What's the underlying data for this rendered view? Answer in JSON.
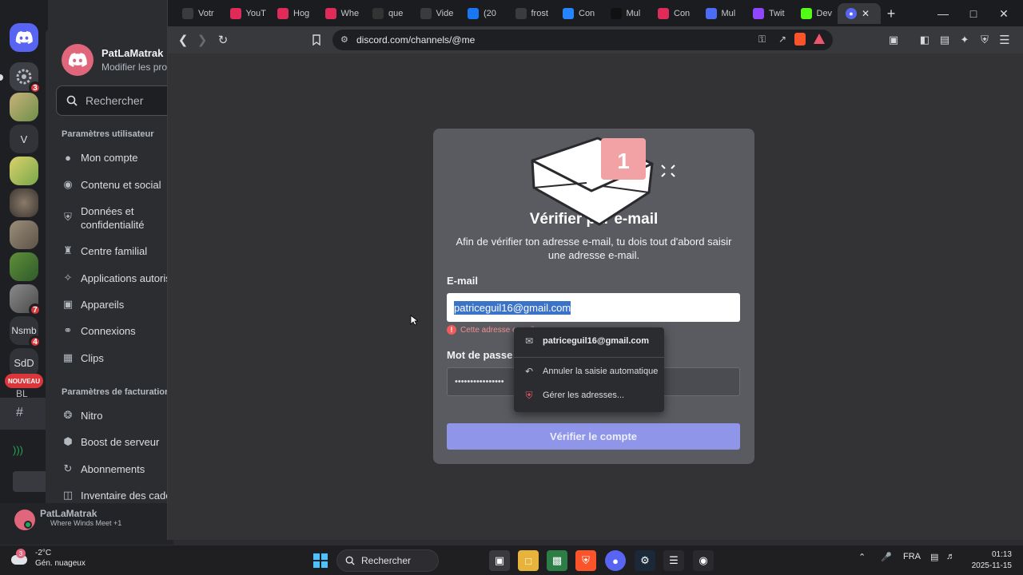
{
  "colors": {
    "discord_blurple": "#5865f2",
    "verify_button": "#8f95e8",
    "error_red": "#f08f8f",
    "notification_badge": "#f2a1a4"
  },
  "discord": {
    "server_rail": {
      "badges": [
        "3",
        "7",
        "4"
      ],
      "labels": [
        "V",
        "Nsmb",
        "SdD",
        "BL"
      ],
      "new_badge": "NOUVEAU"
    },
    "settings": {
      "profile_name": "PatLaMatrak",
      "profile_sub": "Modifier les profils",
      "search_placeholder": "Rechercher",
      "user_section": "Paramètres utilisateur",
      "user_items": [
        {
          "label": "Mon compte",
          "icon": "person-icon"
        },
        {
          "label": "Contenu et social",
          "icon": "social-icon"
        },
        {
          "label": "Données et confidentialité",
          "icon": "shield-icon"
        },
        {
          "label": "Centre familial",
          "icon": "family-icon"
        },
        {
          "label": "Applications autorisées",
          "icon": "apps-icon"
        },
        {
          "label": "Appareils",
          "icon": "devices-icon"
        },
        {
          "label": "Connexions",
          "icon": "link-icon"
        },
        {
          "label": "Clips",
          "icon": "clips-icon"
        }
      ],
      "billing_section": "Paramètres de facturation",
      "billing_items": [
        {
          "label": "Nitro",
          "icon": "nitro-icon"
        },
        {
          "label": "Boost de serveur",
          "icon": "boost-icon"
        },
        {
          "label": "Abonnements",
          "icon": "subscriptions-icon"
        },
        {
          "label": "Inventaire des cadeaux",
          "icon": "gift-icon"
        }
      ]
    },
    "user_panel": {
      "name": "PatLaMatrak",
      "status": "Where Winds Meet +1"
    }
  },
  "browser": {
    "tabs": [
      {
        "label": "Votr",
        "icon": "gmail-icon",
        "color": "#3a3b3f"
      },
      {
        "label": "YouT",
        "icon": "youtube-icon",
        "color": "#e02b5a"
      },
      {
        "label": "Hog",
        "icon": "youtube-icon",
        "color": "#e02b5a"
      },
      {
        "label": "Whe",
        "icon": "youtube-icon",
        "color": "#e02b5a"
      },
      {
        "label": "que",
        "icon": "github-icon",
        "color": "#333333"
      },
      {
        "label": "Vide",
        "icon": "chatgpt-icon",
        "color": "#3a3b3f"
      },
      {
        "label": "(20",
        "icon": "facebook-icon",
        "color": "#1877f2"
      },
      {
        "label": "frost",
        "icon": "frost-icon",
        "color": "#3a3b3f"
      },
      {
        "label": "Con",
        "icon": "confluence-icon",
        "color": "#2684ff"
      },
      {
        "label": "Mul",
        "icon": "k-icon",
        "color": "#111111"
      },
      {
        "label": "Con",
        "icon": "youtube-icon",
        "color": "#e02b5a"
      },
      {
        "label": "Mul",
        "icon": "grid-icon",
        "color": "#4a6cf7"
      },
      {
        "label": "Twit",
        "icon": "twitch-icon",
        "color": "#9146ff"
      },
      {
        "label": "Dev",
        "icon": "kick-icon",
        "color": "#53fc18"
      }
    ],
    "url": "discord.com/channels/@me"
  },
  "modal": {
    "title": "Vérifier par e-mail",
    "description": "Afin de vérifier ton adresse e-mail, tu dois tout d'abord saisir une adresse e-mail.",
    "notification_count": "1",
    "email_label": "E-mail",
    "email_value": "patriceguil16@gmail.com",
    "error_text": "Cette adresse e-mail",
    "password_label": "Mot de passe",
    "password_value": "••••••••••••••••",
    "verify_button": "Vérifier le compte"
  },
  "autofill": {
    "suggestion": "patriceguil16@gmail.com",
    "cancel": "Annuler la saisie automatique",
    "manage": "Gérer les adresses..."
  },
  "taskbar": {
    "temperature": "-2°C",
    "weather": "Gén. nuageux",
    "weather_badge": "3",
    "search": "Rechercher",
    "language": "FRA",
    "time": "01:13",
    "date": "2025-11-15"
  }
}
